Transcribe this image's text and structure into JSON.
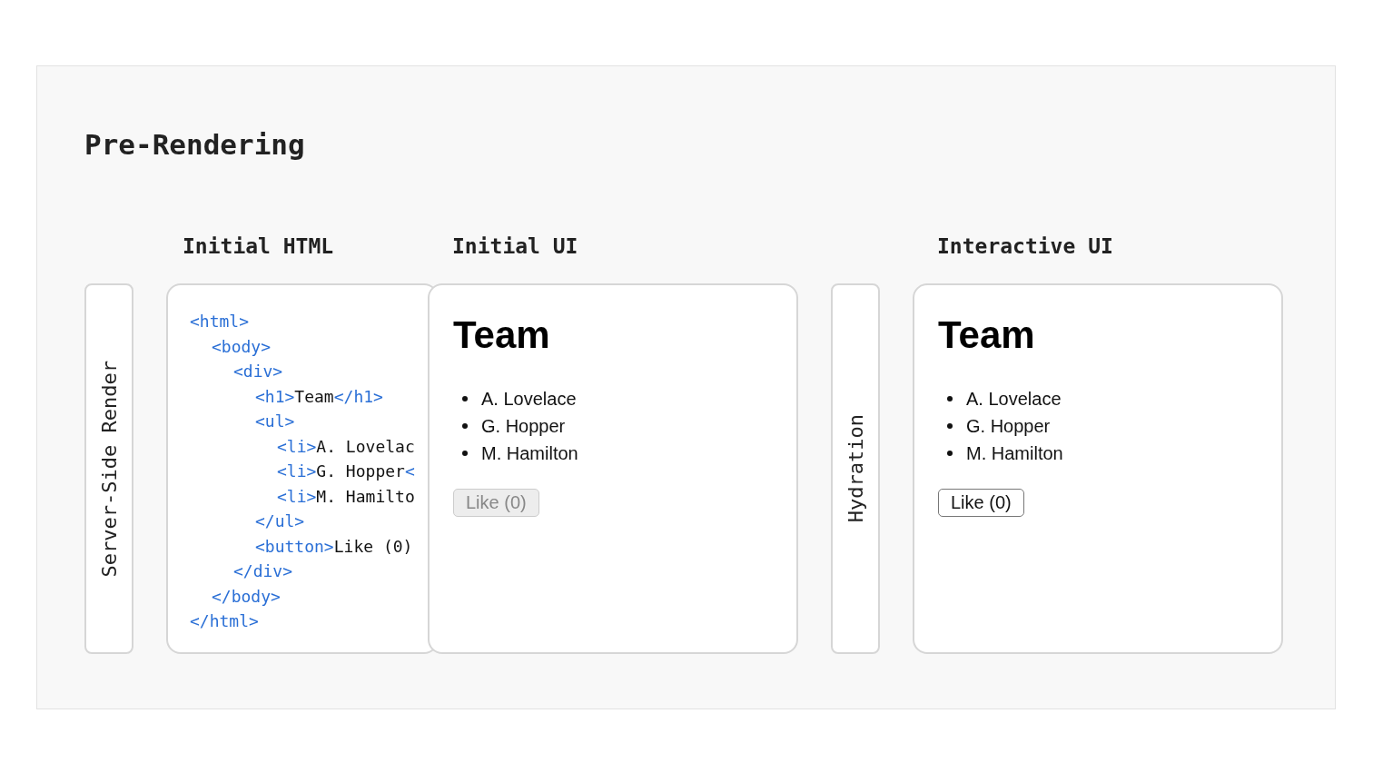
{
  "title": "Pre-Rendering",
  "stages": [
    {
      "kind": "side",
      "label": "Server-Side Render"
    },
    {
      "kind": "code",
      "heading": "Initial HTML",
      "lines": [
        {
          "segments": [
            {
              "kind": "tag",
              "text": "<html>"
            }
          ],
          "children": [
            {
              "segments": [
                {
                  "kind": "tag",
                  "text": "<body>"
                }
              ],
              "children": [
                {
                  "segments": [
                    {
                      "kind": "tag",
                      "text": "<div>"
                    }
                  ],
                  "children": [
                    {
                      "segments": [
                        {
                          "kind": "tag",
                          "text": "<h1>"
                        },
                        {
                          "kind": "text",
                          "text": "Team"
                        },
                        {
                          "kind": "tag",
                          "text": "</h1>"
                        }
                      ]
                    },
                    {
                      "segments": [
                        {
                          "kind": "tag",
                          "text": "<ul>"
                        }
                      ],
                      "children": [
                        {
                          "segments": [
                            {
                              "kind": "tag",
                              "text": "<li>"
                            },
                            {
                              "kind": "text",
                              "text": "A. Lovelac"
                            }
                          ]
                        },
                        {
                          "segments": [
                            {
                              "kind": "tag",
                              "text": "<li>"
                            },
                            {
                              "kind": "text",
                              "text": "G. Hopper"
                            },
                            {
                              "kind": "tag",
                              "text": "<"
                            }
                          ]
                        },
                        {
                          "segments": [
                            {
                              "kind": "tag",
                              "text": "<li>"
                            },
                            {
                              "kind": "text",
                              "text": "M. Hamilto"
                            }
                          ]
                        }
                      ]
                    },
                    {
                      "segments": [
                        {
                          "kind": "tag",
                          "text": "</ul>"
                        }
                      ]
                    },
                    {
                      "segments": [
                        {
                          "kind": "tag",
                          "text": "<button>"
                        },
                        {
                          "kind": "text",
                          "text": "Like (0)"
                        }
                      ]
                    }
                  ]
                },
                {
                  "segments": [
                    {
                      "kind": "tag",
                      "text": "</div>"
                    }
                  ]
                }
              ]
            },
            {
              "segments": [
                {
                  "kind": "tag",
                  "text": "</body>"
                }
              ]
            }
          ]
        },
        {
          "segments": [
            {
              "kind": "tag",
              "text": "</html>"
            }
          ]
        }
      ]
    },
    {
      "kind": "ui",
      "heading": "Initial UI",
      "title": "Team",
      "items": [
        "A. Lovelace",
        "G. Hopper",
        "M. Hamilton"
      ],
      "button": {
        "label": "Like (0)",
        "disabled": true
      }
    },
    {
      "kind": "side",
      "label": "Hydration"
    },
    {
      "kind": "ui",
      "heading": "Interactive UI",
      "title": "Team",
      "items": [
        "A. Lovelace",
        "G. Hopper",
        "M. Hamilton"
      ],
      "button": {
        "label": "Like (0)",
        "disabled": false
      }
    }
  ]
}
